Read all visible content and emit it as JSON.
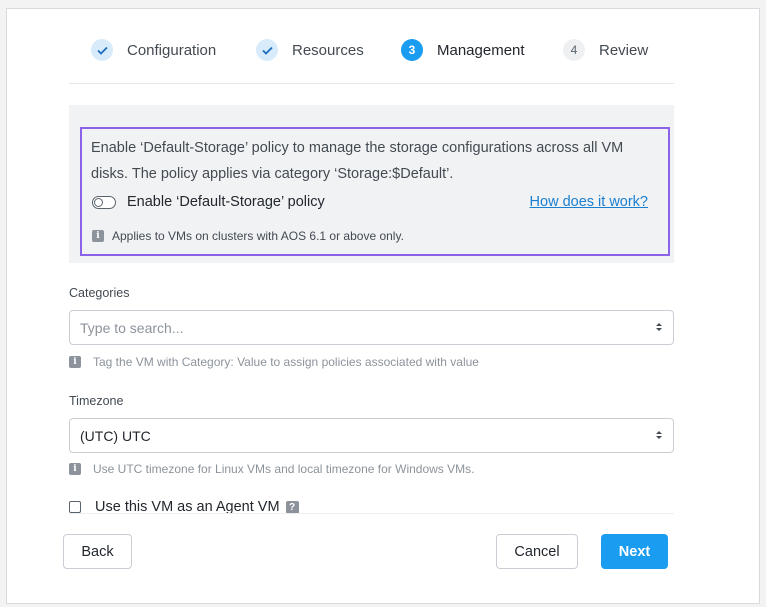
{
  "stepper": {
    "steps": [
      {
        "number": "",
        "label": "Configuration",
        "state": "completed"
      },
      {
        "number": "",
        "label": "Resources",
        "state": "completed"
      },
      {
        "number": "3",
        "label": "Management",
        "state": "active"
      },
      {
        "number": "4",
        "label": "Review",
        "state": "pending"
      }
    ]
  },
  "policy": {
    "description": "Enable ‘Default-Storage’ policy to manage the storage configurations across all VM disks. The policy applies via category ‘Storage:$Default’.",
    "toggle_label": "Enable ‘Default-Storage’ policy",
    "toggle_state": "off",
    "link_text": "How does it work?",
    "info_text": "Applies to VMs on clusters with AOS 6.1 or above only."
  },
  "categories": {
    "label": "Categories",
    "placeholder": "Type to search...",
    "help": "Tag the VM with Category: Value to assign policies associated with value"
  },
  "timezone": {
    "label": "Timezone",
    "value": "(UTC) UTC",
    "help": "Use UTC timezone for Linux VMs and local timezone for Windows VMs."
  },
  "agent_vm": {
    "label": "Use this VM as an Agent VM",
    "checked": false
  },
  "footer": {
    "back_label": "Back",
    "cancel_label": "Cancel",
    "next_label": "Next"
  },
  "icons": {
    "completed_step": "check-icon",
    "info": "info-icon",
    "help": "question-icon",
    "select_caret": "sort-caret-icon"
  },
  "colors": {
    "accent": "#1a9cf0",
    "link": "#1a7fd0",
    "highlight_border": "#8a63e8"
  }
}
